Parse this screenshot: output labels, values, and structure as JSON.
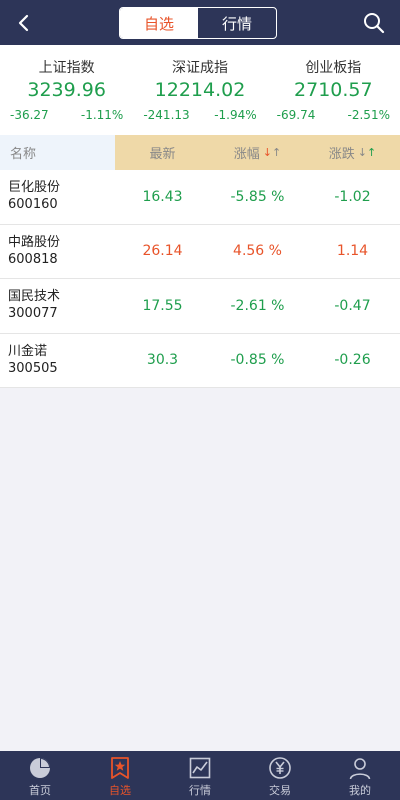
{
  "header": {
    "tabs": [
      {
        "label": "自选",
        "active": true
      },
      {
        "label": "行情",
        "active": false
      }
    ]
  },
  "indices": [
    {
      "name": "上证指数",
      "value": "3239.96",
      "change": "-36.27",
      "pct": "-1.11%"
    },
    {
      "name": "深证成指",
      "value": "12214.02",
      "change": "-241.13",
      "pct": "-1.94%"
    },
    {
      "name": "创业板指",
      "value": "2710.57",
      "change": "-69.74",
      "pct": "-2.51%"
    }
  ],
  "table": {
    "headers": {
      "name": "名称",
      "latest": "最新",
      "pct": "涨幅",
      "change": "涨跌"
    },
    "rows": [
      {
        "name": "巨化股份",
        "code": "600160",
        "latest": "16.43",
        "pct": "-5.85 %",
        "change": "-1.02"
      },
      {
        "name": "中路股份",
        "code": "600818",
        "latest": "26.14",
        "pct": "4.56 %",
        "change": "1.14"
      },
      {
        "name": "国民技术",
        "code": "300077",
        "latest": "17.55",
        "pct": "-2.61 %",
        "change": "-0.47"
      },
      {
        "name": "川金诺",
        "code": "300505",
        "latest": "30.3",
        "pct": "-0.85 %",
        "change": "-0.26"
      }
    ]
  },
  "bottom_nav": [
    {
      "label": "首页",
      "icon": "pie-chart-icon",
      "active": false
    },
    {
      "label": "自选",
      "icon": "star-bookmark-icon",
      "active": true
    },
    {
      "label": "行情",
      "icon": "line-chart-icon",
      "active": false
    },
    {
      "label": "交易",
      "icon": "yen-coin-icon",
      "active": false
    },
    {
      "label": "我的",
      "icon": "user-icon",
      "active": false
    }
  ],
  "colors": {
    "header_bg": "#2d3558",
    "accent": "#e8542a",
    "down": "#1f9e4d",
    "up": "#e8542a",
    "header_highlight": "#efd9a8"
  }
}
